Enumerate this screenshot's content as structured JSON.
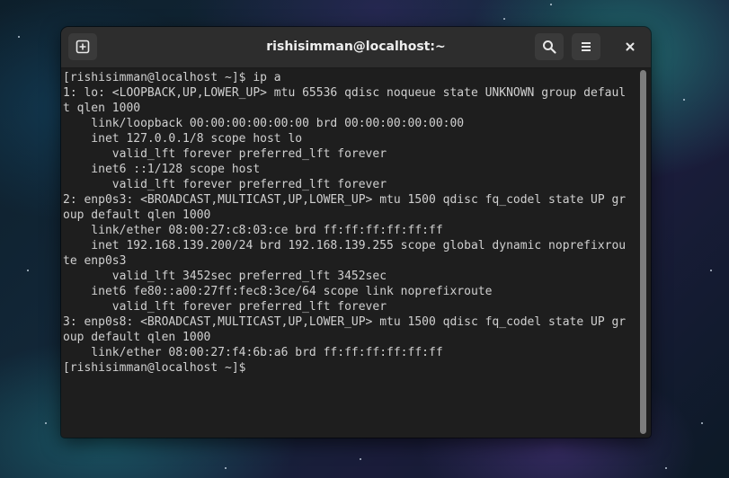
{
  "window": {
    "title": "rishisimman@localhost:~"
  },
  "headerbar": {
    "new_tab_icon": "new-tab-icon",
    "search_icon": "search-icon",
    "menu_icon": "hamburger-menu-icon",
    "close_icon": "close-icon"
  },
  "terminal": {
    "lines": [
      "[rishisimman@localhost ~]$ ip a",
      "1: lo: <LOOPBACK,UP,LOWER_UP> mtu 65536 qdisc noqueue state UNKNOWN group defaul",
      "t qlen 1000",
      "    link/loopback 00:00:00:00:00:00 brd 00:00:00:00:00:00",
      "    inet 127.0.0.1/8 scope host lo",
      "       valid_lft forever preferred_lft forever",
      "    inet6 ::1/128 scope host",
      "       valid_lft forever preferred_lft forever",
      "2: enp0s3: <BROADCAST,MULTICAST,UP,LOWER_UP> mtu 1500 qdisc fq_codel state UP gr",
      "oup default qlen 1000",
      "    link/ether 08:00:27:c8:03:ce brd ff:ff:ff:ff:ff:ff",
      "    inet 192.168.139.200/24 brd 192.168.139.255 scope global dynamic noprefixrou",
      "te enp0s3",
      "       valid_lft 3452sec preferred_lft 3452sec",
      "    inet6 fe80::a00:27ff:fec8:3ce/64 scope link noprefixroute",
      "       valid_lft forever preferred_lft forever",
      "3: enp0s8: <BROADCAST,MULTICAST,UP,LOWER_UP> mtu 1500 qdisc fq_codel state UP gr",
      "oup default qlen 1000",
      "    link/ether 08:00:27:f4:6b:a6 brd ff:ff:ff:ff:ff:ff",
      "[rishisimman@localhost ~]$ "
    ]
  },
  "colors": {
    "terminal_bg": "#1e1e1e",
    "terminal_fg": "#d0d0d0",
    "headerbar_bg": "#2d2d2d"
  }
}
